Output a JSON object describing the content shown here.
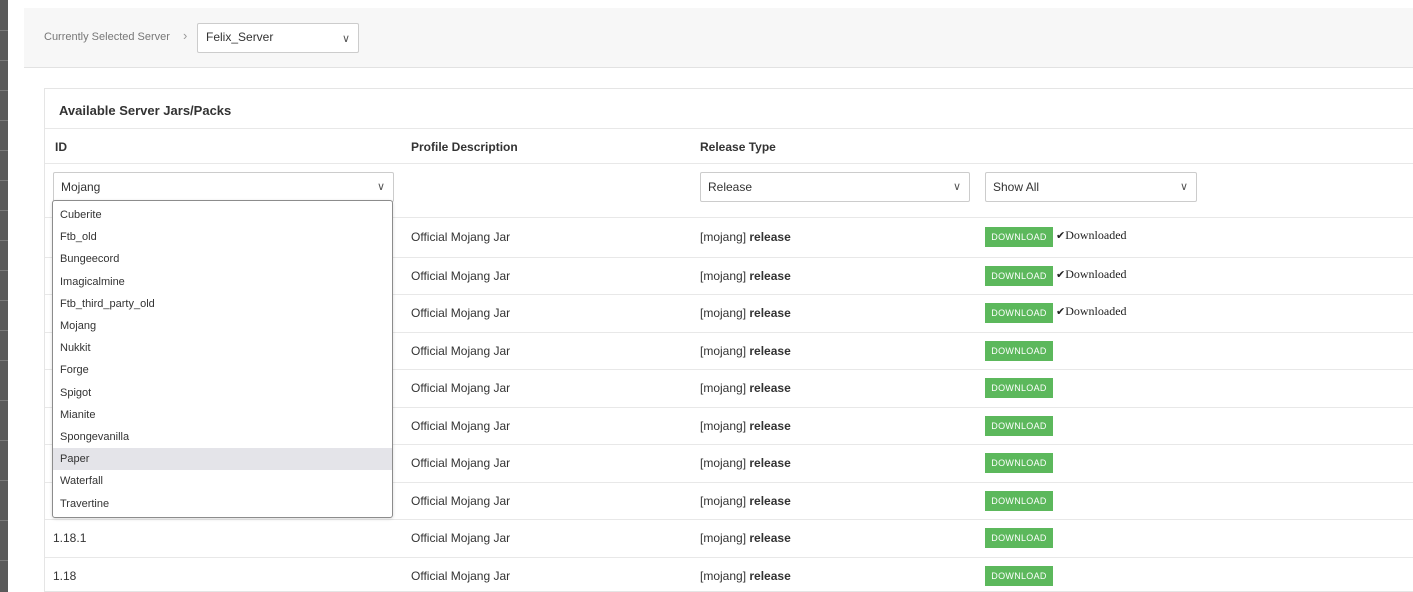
{
  "breadcrumb": {
    "label": "Currently Selected Server",
    "separator": ">"
  },
  "server_select": {
    "value": "Felix_Server"
  },
  "panel": {
    "title": "Available Server Jars/Packs"
  },
  "table": {
    "headers": {
      "id": "ID",
      "description": "Profile Description",
      "release_type": "Release Type"
    },
    "filters": {
      "id": "Mojang",
      "release_type": "Release",
      "download_status": "Show All"
    },
    "rows": [
      {
        "id": "",
        "description": "Official Mojang Jar",
        "source": "[mojang]",
        "type": "release",
        "button": "DOWNLOAD",
        "status": "Downloaded"
      },
      {
        "id": "",
        "description": "Official Mojang Jar",
        "source": "[mojang]",
        "type": "release",
        "button": "DOWNLOAD",
        "status": "Downloaded"
      },
      {
        "id": "",
        "description": "Official Mojang Jar",
        "source": "[mojang]",
        "type": "release",
        "button": "DOWNLOAD",
        "status": "Downloaded"
      },
      {
        "id": "",
        "description": "Official Mojang Jar",
        "source": "[mojang]",
        "type": "release",
        "button": "DOWNLOAD",
        "status": ""
      },
      {
        "id": "",
        "description": "Official Mojang Jar",
        "source": "[mojang]",
        "type": "release",
        "button": "DOWNLOAD",
        "status": ""
      },
      {
        "id": "",
        "description": "Official Mojang Jar",
        "source": "[mojang]",
        "type": "release",
        "button": "DOWNLOAD",
        "status": ""
      },
      {
        "id": "",
        "description": "Official Mojang Jar",
        "source": "[mojang]",
        "type": "release",
        "button": "DOWNLOAD",
        "status": ""
      },
      {
        "id": "",
        "description": "Official Mojang Jar",
        "source": "[mojang]",
        "type": "release",
        "button": "DOWNLOAD",
        "status": ""
      },
      {
        "id": "1.18.1",
        "description": "Official Mojang Jar",
        "source": "[mojang]",
        "type": "release",
        "button": "DOWNLOAD",
        "status": ""
      },
      {
        "id": "1.18",
        "description": "Official Mojang Jar",
        "source": "[mojang]",
        "type": "release",
        "button": "DOWNLOAD",
        "status": ""
      }
    ]
  },
  "dropdown": {
    "options": [
      "Cuberite",
      "Ftb_old",
      "Bungeecord",
      "Imagicalmine",
      "Ftb_third_party_old",
      "Mojang",
      "Nukkit",
      "Forge",
      "Spigot",
      "Mianite",
      "Spongevanilla",
      "Paper",
      "Waterfall",
      "Travertine"
    ],
    "highlighted": "Paper"
  },
  "colors": {
    "download_button": "#5cb85c",
    "highlight": "#e4e4e9",
    "left_strip": "#5a5a5a"
  },
  "icons": {
    "chevron": "chevron-down-icon",
    "check": "check-icon",
    "breadcrumb": "chevron-right-icon"
  }
}
